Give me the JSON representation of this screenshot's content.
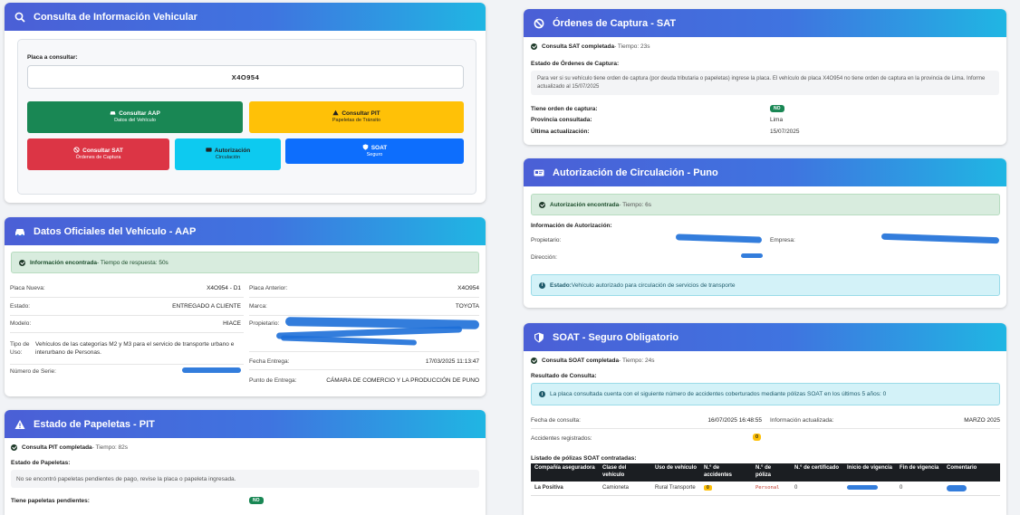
{
  "vehicle_query": {
    "title": "Consulta de Información Vehicular",
    "plate_label": "Placa a consultar:",
    "plate_value": "X4O954",
    "buttons": {
      "aap": {
        "label": "Consultar AAP",
        "sub": "Datos del Vehículo"
      },
      "pit": {
        "label": "Consultar PIT",
        "sub": "Papeletas de Tránsito"
      },
      "sat": {
        "label": "Consultar SAT",
        "sub": "Órdenes de Captura"
      },
      "auth": {
        "label": "Autorización",
        "sub": "Circulación"
      },
      "soat": {
        "label": "SOAT",
        "sub": "Seguro"
      }
    }
  },
  "aap": {
    "title": "Datos Oficiales del Vehículo - AAP",
    "alert_bold": "Información encontrada",
    "alert_rest": " - Tiempo de respuesta: 50s",
    "placa_nueva_label": "Placa Nueva:",
    "placa_nueva": "X4O954 - D1",
    "placa_anterior_label": "Placa Anterior:",
    "placa_anterior": "X4O954",
    "estado_label": "Estado:",
    "estado": "ENTREGADO A CLIENTE",
    "marca_label": "Marca:",
    "marca": "TOYOTA",
    "modelo_label": "Modelo:",
    "modelo": "HIACE",
    "propietario_label": "Propietario:",
    "tipo_uso_label": "Tipo de Uso:",
    "tipo_uso": "Vehículos de las categorías M2 y M3 para el servicio de transporte urbano e interurbano de Personas.",
    "fecha_entrega_label": "Fecha Entrega:",
    "fecha_entrega": "17/03/2025 11:13:47",
    "serie_label": "Número de Serie:",
    "punto_label": "Punto de Entrega:",
    "punto": "CÁMARA DE COMERCIO Y LA PRODUCCIÓN DE PUNO"
  },
  "pit": {
    "title": "Estado de Papeletas - PIT",
    "status_bold": "Consulta PIT completada",
    "status_rest": " - Tiempo: 82s",
    "estado_label": "Estado de Papeletas:",
    "message": "No se encontró papeletas pendientes de pago, revise la placa o papeleta ingresada.",
    "pendientes_label": "Tiene papeletas pendientes:",
    "pendientes_value": "NO"
  },
  "sat": {
    "title": "Órdenes de Captura - SAT",
    "status_bold": "Consulta SAT completada",
    "status_rest": " - Tiempo: 23s",
    "estado_label": "Estado de Órdenes de Captura:",
    "message": "Para ver si su vehículo tiene orden de captura (por deuda tributaria o papeletas) ingrese la placa. El vehículo de placa X4O954 no tiene orden de captura en la provincia de Lima. Informe actualizado al 15/07/2025",
    "orden_label": "Tiene orden de captura:",
    "orden_value": "NO",
    "provincia_label": "Provincia consultada:",
    "provincia_value": "Lima",
    "actualizacion_label": "Última actualización:",
    "actualizacion_value": "15/07/2025"
  },
  "auth": {
    "title": "Autorización de Circulación - Puno",
    "alert_bold": "Autorización encontrada",
    "alert_rest": " - Tiempo: 6s",
    "info_label": "Información de Autorización:",
    "propietario_label": "Propietario:",
    "empresa_label": "Empresa:",
    "direccion_label": "Dirección:",
    "estado_bold": "Estado:",
    "estado_rest": " Vehículo autorizado para circulación de servicios de transporte"
  },
  "soat": {
    "title": "SOAT - Seguro Obligatorio",
    "status_bold": "Consulta SOAT completada",
    "status_rest": " - Tiempo: 24s",
    "resultado_label": "Resultado de Consulta:",
    "info": "La placa consultada cuenta con el siguiente número de accidentes coberturados mediante pólizas SOAT en los últimos 5 años: 0",
    "fecha_label": "Fecha de consulta:",
    "fecha_value": "16/07/2025 16:48:55",
    "actualizada_label": "Información actualizada:",
    "actualizada_value": "MARZO 2025",
    "accidentes_label": "Accidentes registrados:",
    "accidentes_value": "0",
    "listado_label": "Listado de pólizas SOAT contratadas:",
    "columns": [
      "Compañía aseguradora",
      "Clase del vehículo",
      "Uso de vehículo",
      "N.° de accidentes",
      "N.° de póliza",
      "N.° de certificado",
      "Inicio de vigencia",
      "Fin de vigencia",
      "Comentario"
    ],
    "rows": [
      [
        "La Positiva",
        "Camioneta",
        "Rural Transporte",
        "0",
        "Personal",
        "0",
        "",
        "0",
        ""
      ]
    ]
  },
  "colors": {
    "green": "#198754",
    "yellow": "#ffc107",
    "red": "#dc3545",
    "cyan": "#0dcaf0",
    "blue": "#0d6efd"
  }
}
